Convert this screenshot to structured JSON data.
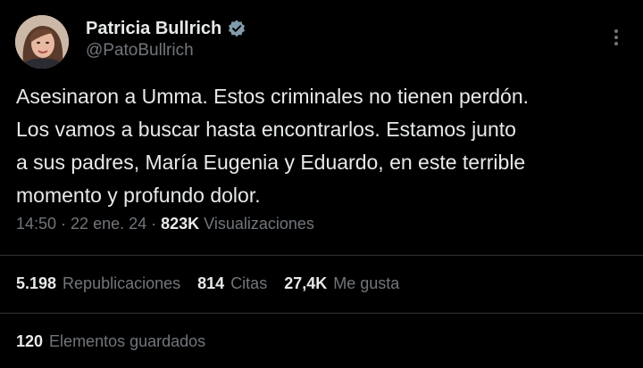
{
  "author": {
    "name": "Patricia Bullrich",
    "handle": "@PatoBullrich",
    "verified": true,
    "verified_color": "#829aab"
  },
  "tweet": {
    "text": "Asesinaron a Umma. Estos criminales no tienen perdón.\nLos vamos a buscar hasta encontrarlos. Estamos junto\na sus padres, María Eugenia y Eduardo, en este terrible\nmomento y profundo dolor."
  },
  "meta": {
    "time": "14:50",
    "separator1": " · ",
    "date": "22 ene. 24",
    "separator2": " · ",
    "views_count": "823K",
    "views_label": " Visualizaciones"
  },
  "stats": {
    "retweets_count": "5.198",
    "retweets_label": "Republicaciones",
    "quotes_count": "814",
    "quotes_label": "Citas",
    "likes_count": "27,4K",
    "likes_label": "Me gusta",
    "bookmarks_count": "120",
    "bookmarks_label": "Elementos guardados"
  },
  "icons": {
    "more": "more-vertical-icon",
    "verified": "verified-badge-icon"
  },
  "colors": {
    "background": "#000000",
    "text_primary": "#e7e9ea",
    "text_secondary": "#71767b",
    "divider": "#2f3336"
  }
}
